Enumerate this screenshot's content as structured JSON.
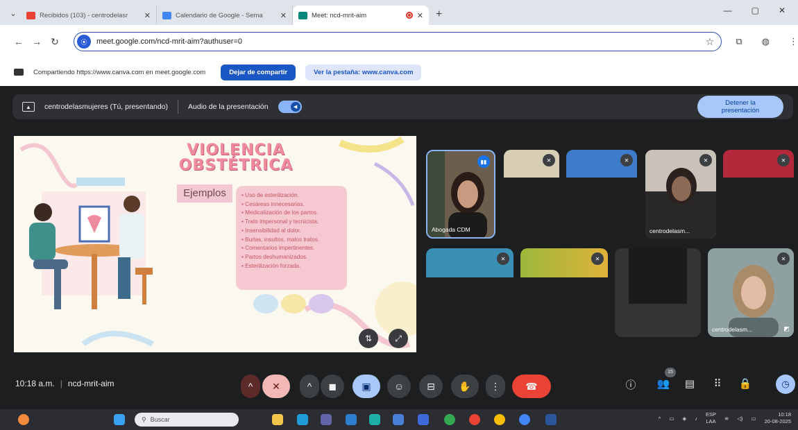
{
  "browser": {
    "tabs": [
      {
        "title": "Recibidos (103) - centrodelasr",
        "favicon_color": "#ea4335",
        "active": false
      },
      {
        "title": "Calendario de Google - Sema",
        "favicon_color": "#4285f4",
        "active": false
      },
      {
        "title": "Meet: ncd-mrit-aim",
        "favicon_color": "#00897b",
        "active": true
      }
    ],
    "url": "meet.google.com/ncd-mrit-aim?authuser=0"
  },
  "sharebar": {
    "text": "Compartiendo https://www.canva.com en meet.google.com",
    "stop_label": "Dejar de compartir",
    "view_label": "Ver la pestaña: www.canva.com"
  },
  "presentation_bar": {
    "presenter": "centrodelasmujeres (Tú, presentando)",
    "audio_label": "Audio de la presentación",
    "stop_line1": "Detener la",
    "stop_line2": "presentación"
  },
  "slide": {
    "title_line1": "VIOLENCIA",
    "title_line2": "OBSTÉTRICA",
    "subtitle": "Ejemplos",
    "items": [
      "Uso de esterilización.",
      "Cesáreas innecesarias.",
      "Medicalización de los partos.",
      "Trato impersonal y tecnicista.",
      "Insensibilidad al dolor.",
      "Burlas, insultos, malos tratos.",
      "Comentarios impertinentes.",
      "Partos deshumanizados.",
      "Esterilización forzada."
    ]
  },
  "participants": {
    "tile_1_name": "Abogada CDM",
    "tile_2_name": "centrodelasm...",
    "tile_3_name": "centrodelasm..."
  },
  "controls": {
    "time": "10:18 a.m.",
    "meeting_code": "ncd-mrit-aim",
    "people_count": "15"
  },
  "taskbar": {
    "search_placeholder": "Buscar",
    "lang1": "ESP",
    "lang2": "LAA",
    "time": "10:18",
    "date": "20-08-2025"
  },
  "colors": {
    "accent_blue": "#1a56c4",
    "meet_bg": "#1d1e20",
    "end_call": "#ea4335",
    "slide_pink": "#f08a9d"
  }
}
